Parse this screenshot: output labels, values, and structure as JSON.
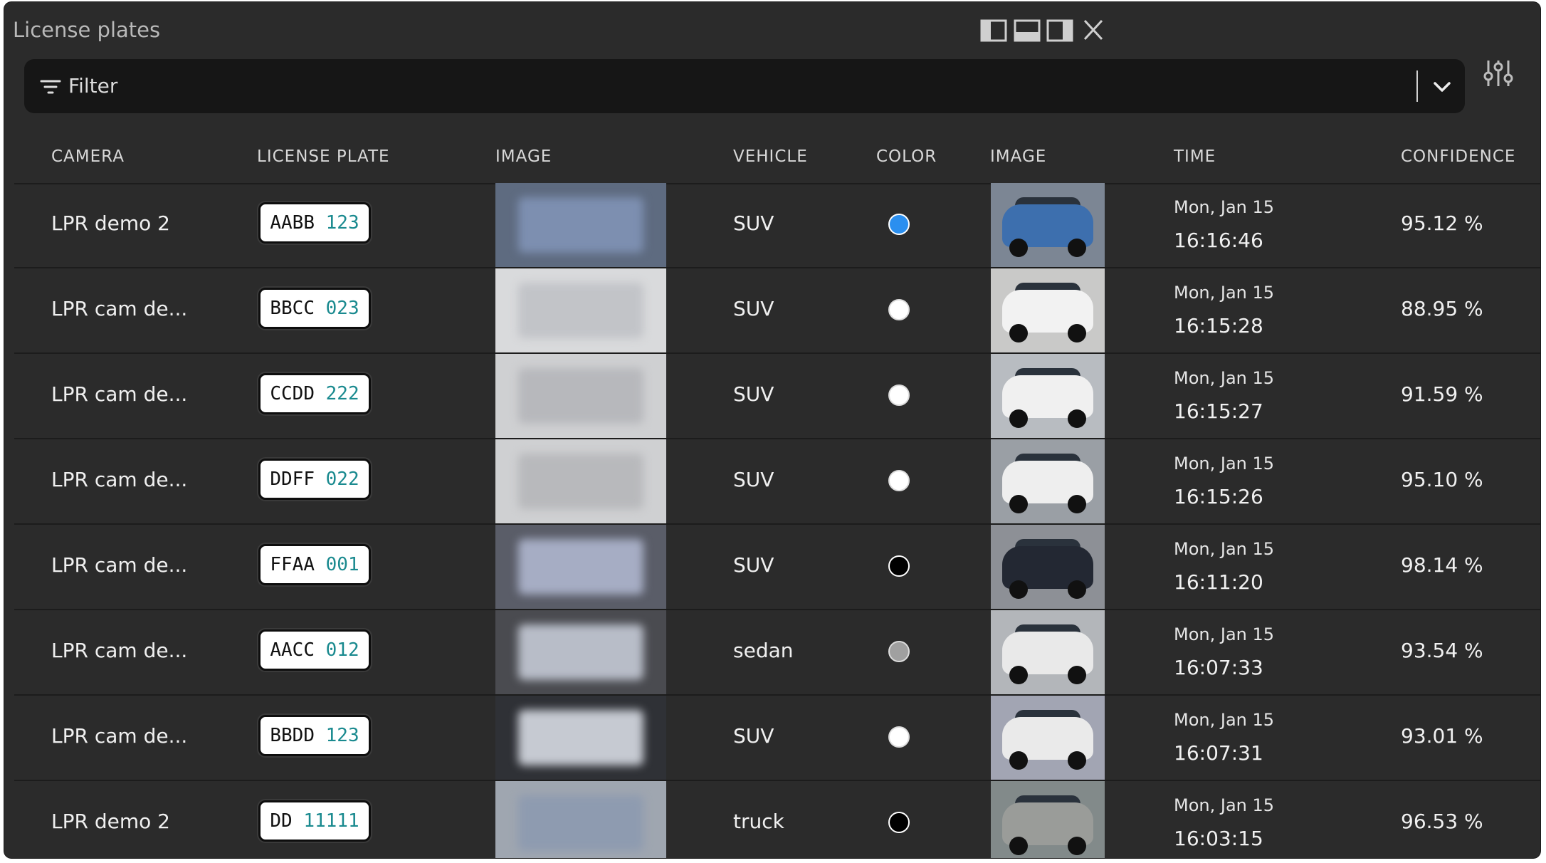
{
  "window": {
    "title": "License plates"
  },
  "filter": {
    "label": "Filter"
  },
  "columns": {
    "camera": "CAMERA",
    "plate": "LICENSE PLATE",
    "image1": "IMAGE",
    "vehicle": "VEHICLE",
    "color": "COLOR",
    "image2": "IMAGE",
    "time": "TIME",
    "confidence": "CONFIDENCE"
  },
  "rows": [
    {
      "camera": "LPR demo 2",
      "plate_letters": "AABB",
      "plate_numbers": "123",
      "vehicle": "SUV",
      "color": "#2b8fef",
      "date": "Mon, Jan 15",
      "time": "16:16:46",
      "confidence": "95.12 %"
    },
    {
      "camera": "LPR cam de...",
      "plate_letters": "BBCC",
      "plate_numbers": "023",
      "vehicle": "SUV",
      "color": "#ffffff",
      "date": "Mon, Jan 15",
      "time": "16:15:28",
      "confidence": "88.95 %"
    },
    {
      "camera": "LPR cam de...",
      "plate_letters": "CCDD",
      "plate_numbers": "222",
      "vehicle": "SUV",
      "color": "#ffffff",
      "date": "Mon, Jan 15",
      "time": "16:15:27",
      "confidence": "91.59 %"
    },
    {
      "camera": "LPR cam de...",
      "plate_letters": "DDFF",
      "plate_numbers": "022",
      "vehicle": "SUV",
      "color": "#ffffff",
      "date": "Mon, Jan 15",
      "time": "16:15:26",
      "confidence": "95.10 %"
    },
    {
      "camera": "LPR cam de...",
      "plate_letters": "FFAA",
      "plate_numbers": "001",
      "vehicle": "SUV",
      "color": "#000000",
      "date": "Mon, Jan 15",
      "time": "16:11:20",
      "confidence": "98.14 %"
    },
    {
      "camera": "LPR cam de...",
      "plate_letters": "AACC",
      "plate_numbers": "012",
      "vehicle": "sedan",
      "color": "#a0a0a0",
      "date": "Mon, Jan 15",
      "time": "16:07:33",
      "confidence": "93.54 %"
    },
    {
      "camera": "LPR cam de...",
      "plate_letters": "BBDD",
      "plate_numbers": "123",
      "vehicle": "SUV",
      "color": "#ffffff",
      "date": "Mon, Jan 15",
      "time": "16:07:31",
      "confidence": "93.01 %"
    },
    {
      "camera": "LPR demo 2",
      "plate_letters": "DD",
      "plate_numbers": "11111",
      "vehicle": "truck",
      "color": "#000000",
      "date": "Mon, Jan 15",
      "time": "16:03:15",
      "confidence": "96.53 %"
    }
  ],
  "icons": {
    "filter": "filter-lines-icon",
    "chevron": "chevron-down-icon",
    "settings": "sliders-icon",
    "layout_left": "layout-left-icon",
    "layout_bottom": "layout-bottom-icon",
    "layout_right": "layout-right-icon",
    "close": "close-icon"
  }
}
